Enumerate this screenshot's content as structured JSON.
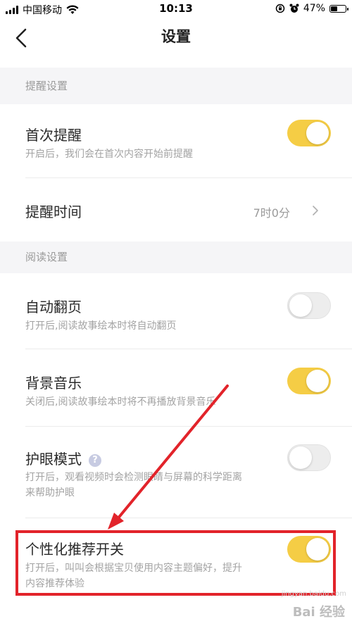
{
  "status_bar": {
    "carrier": "中国移动",
    "time": "10:13",
    "battery": "47%",
    "battery_level": 0.47,
    "icons": [
      "signal-icon",
      "wifi-icon",
      "orientation-lock-icon",
      "alarm-icon",
      "battery-icon"
    ]
  },
  "nav": {
    "title": "设置",
    "back_icon": "chevron-left-icon"
  },
  "sections": {
    "reminder": {
      "header": "提醒设置",
      "first_reminder": {
        "title": "首次提醒",
        "desc": "开启后，我们会在首次内容开始前提醒",
        "enabled": true
      },
      "reminder_time": {
        "title": "提醒时间",
        "value": "7时0分"
      }
    },
    "reading": {
      "header": "阅读设置",
      "auto_page": {
        "title": "自动翻页",
        "desc": "打开后,阅读故事绘本时将自动翻页",
        "enabled": false
      },
      "bg_music": {
        "title": "背景音乐",
        "desc": "关闭后,阅读故事绘本时将不再播放背景音乐",
        "enabled": true
      },
      "eye_care": {
        "title": "护眼模式",
        "help": "?",
        "desc_line1": "打开后，观看视频时会检测眼睛与屏幕的科学距离",
        "desc_line2": "来帮助护眼",
        "enabled": false
      },
      "personalized": {
        "title": "个性化推荐开关",
        "desc_line1": "打开后，叫叫会根据宝贝使用内容主题偏好，提升",
        "desc_line2": "内容推荐体验",
        "enabled": true
      }
    }
  },
  "annotation": {
    "color": "#e2232a"
  },
  "watermark": {
    "brand": "Bai 经验",
    "url": "jingyan.baidu.com"
  },
  "colors": {
    "toggle_on": "#f5cd45",
    "toggle_off": "#ededed",
    "section_bg": "#f5f5f7"
  }
}
